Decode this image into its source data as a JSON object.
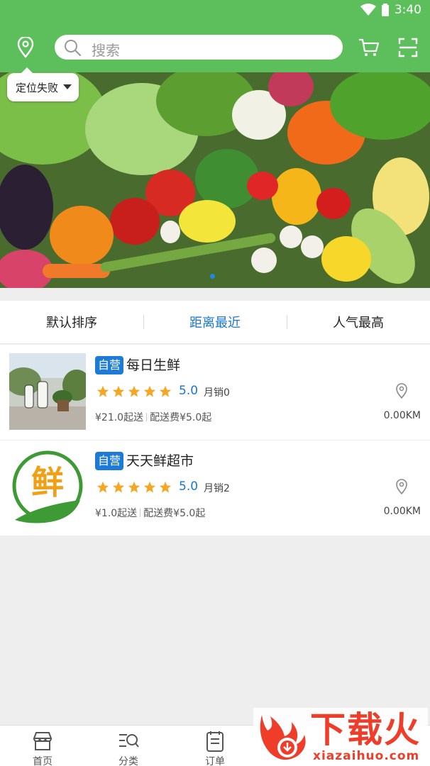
{
  "status_bar": {
    "time": "3:40",
    "icons": [
      "wifi-icon",
      "battery-icon"
    ]
  },
  "header": {
    "search_placeholder": "搜索",
    "icons": [
      "location-icon",
      "search-icon",
      "cart-icon",
      "scan-icon"
    ]
  },
  "location_popup": {
    "label": "定位失败"
  },
  "banner": {
    "active_slide": 1,
    "slides": 1
  },
  "sort_tabs": [
    {
      "label": "默认排序",
      "active": false
    },
    {
      "label": "距离最近",
      "active": true
    },
    {
      "label": "人气最高",
      "active": false
    }
  ],
  "stores": [
    {
      "badge": "自营",
      "name": "每日生鲜",
      "stars": 5,
      "rating": "5.0",
      "monthly_sales": "月销0",
      "min_order": "¥21.0起送",
      "delivery_fee": "配送费¥5.0起",
      "distance": "0.00KM"
    },
    {
      "badge": "自营",
      "name": "天天鲜超市",
      "logo_text": "鲜",
      "stars": 5,
      "rating": "5.0",
      "monthly_sales": "月销2",
      "min_order": "¥1.0起送",
      "delivery_fee": "配送费¥5.0起",
      "distance": "0.00KM"
    }
  ],
  "tab_bar": [
    {
      "label": "首页",
      "icon": "store-icon"
    },
    {
      "label": "分类",
      "icon": "category-icon"
    },
    {
      "label": "订单",
      "icon": "order-icon"
    }
  ],
  "watermark": {
    "text_cn": "下载火",
    "text_en": "xiazaihuo.com"
  },
  "colors": {
    "header_green": "#5cbf5b",
    "accent_blue": "#1976d2",
    "badge_blue": "#1d7bd8",
    "star_orange": "#f5a623",
    "watermark_red": "#ef3d2a"
  }
}
